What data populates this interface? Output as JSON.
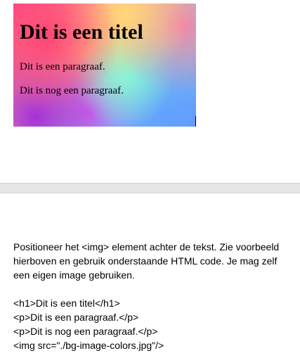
{
  "preview": {
    "title": "Dit is een titel",
    "paragraph_1": "Dit is een paragraaf.",
    "paragraph_2": "Dit is nog een paragraaf."
  },
  "instructions": {
    "text": "Positioneer het <img> element achter de tekst. Zie voorbeeld hierboven en gebruik onderstaande HTML code. Je mag zelf een eigen image gebruiken.",
    "code_lines": [
      "<h1>Dit is een titel</h1>",
      "<p>Dit is een paragraaf.</p>",
      "<p>Dit is nog een paragraaf.</p>",
      "<img src=\"./bg-image-colors.jpg\"/>"
    ]
  },
  "colors": {
    "splitter": "#e6e6e6",
    "text": "#000000",
    "background": "#ffffff"
  }
}
